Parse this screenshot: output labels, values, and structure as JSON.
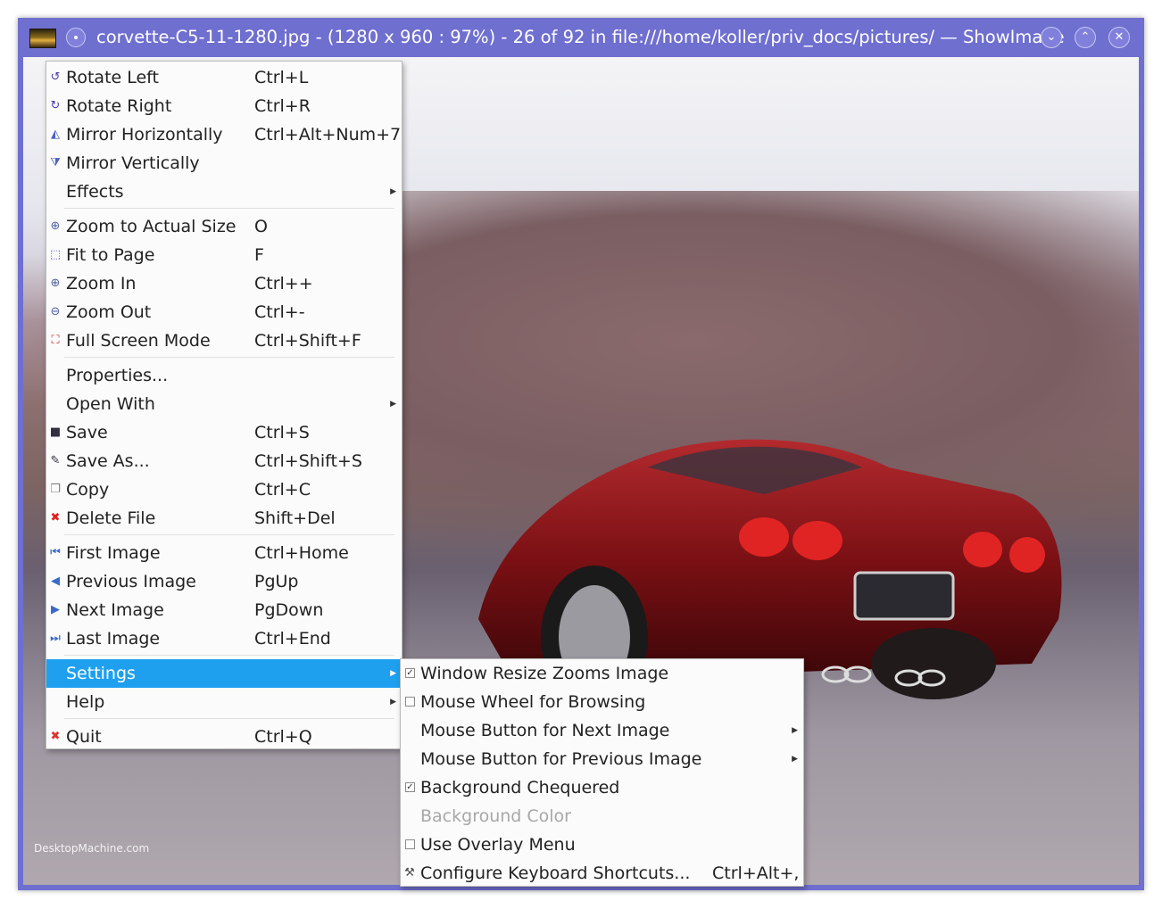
{
  "window": {
    "title": "corvette-C5-11-1280.jpg - (1280 x 960 : 97%) - 26 of 92 in file:///home/koller/priv_docs/pictures/ — ShowImage",
    "buttons": {
      "minimize": "⌄",
      "maximize": "⌃",
      "close": "✕"
    }
  },
  "photo": {
    "watermark": "DesktopMachine.com"
  },
  "main_menu": [
    {
      "id": "rotate-left",
      "label": "Rotate Left",
      "shortcut": "Ctrl+L",
      "icon": "rotate-left-icon",
      "glyph": "↺",
      "color": "#4a3fb0"
    },
    {
      "id": "rotate-right",
      "label": "Rotate Right",
      "shortcut": "Ctrl+R",
      "icon": "rotate-right-icon",
      "glyph": "↻",
      "color": "#4a3fb0"
    },
    {
      "id": "mirror-horizontally",
      "label": "Mirror Horizontally",
      "shortcut": "Ctrl+Alt+Num+7",
      "icon": "mirror-horizontal-icon",
      "glyph": "◭",
      "color": "#4a60c0"
    },
    {
      "id": "mirror-vertically",
      "label": "Mirror Vertically",
      "shortcut": "",
      "icon": "mirror-vertical-icon",
      "glyph": "⧩",
      "color": "#4a60c0"
    },
    {
      "id": "effects",
      "label": "Effects",
      "shortcut": "",
      "submenu": true
    },
    {
      "id": "zoom-actual",
      "label": "Zoom to Actual Size",
      "shortcut": "O",
      "icon": "zoom-actual-icon",
      "glyph": "⊕",
      "color": "#5060a0"
    },
    {
      "id": "fit-to-page",
      "label": "Fit to Page",
      "shortcut": "F",
      "icon": "fit-page-icon",
      "glyph": "⬚",
      "color": "#5060a0"
    },
    {
      "id": "zoom-in",
      "label": "Zoom In",
      "shortcut": "Ctrl++",
      "icon": "zoom-in-icon",
      "glyph": "⊕",
      "color": "#5060a0"
    },
    {
      "id": "zoom-out",
      "label": "Zoom Out",
      "shortcut": "Ctrl+-",
      "icon": "zoom-out-icon",
      "glyph": "⊖",
      "color": "#5060a0"
    },
    {
      "id": "full-screen",
      "label": "Full Screen Mode",
      "shortcut": "Ctrl+Shift+F",
      "icon": "fullscreen-icon",
      "glyph": "⛶",
      "color": "#c03030"
    },
    {
      "id": "properties",
      "label": "Properties...",
      "shortcut": ""
    },
    {
      "id": "open-with",
      "label": "Open With",
      "shortcut": "",
      "submenu": true
    },
    {
      "id": "save",
      "label": "Save",
      "shortcut": "Ctrl+S",
      "icon": "save-icon",
      "glyph": "■",
      "color": "#303040"
    },
    {
      "id": "save-as",
      "label": "Save As...",
      "shortcut": "Ctrl+Shift+S",
      "icon": "save-as-icon",
      "glyph": "✎",
      "color": "#303040"
    },
    {
      "id": "copy",
      "label": "Copy",
      "shortcut": "Ctrl+C",
      "icon": "copy-icon",
      "glyph": "❐",
      "color": "#808080"
    },
    {
      "id": "delete-file",
      "label": "Delete File",
      "shortcut": "Shift+Del",
      "icon": "delete-icon",
      "glyph": "✖",
      "color": "#e02020"
    },
    {
      "id": "first-image",
      "label": "First Image",
      "shortcut": "Ctrl+Home",
      "icon": "first-image-icon",
      "glyph": "⏮",
      "color": "#3a6ac8"
    },
    {
      "id": "previous-image",
      "label": "Previous Image",
      "shortcut": "PgUp",
      "icon": "previous-image-icon",
      "glyph": "◀",
      "color": "#3a6ac8"
    },
    {
      "id": "next-image",
      "label": "Next Image",
      "shortcut": "PgDown",
      "icon": "next-image-icon",
      "glyph": "▶",
      "color": "#3a6ac8"
    },
    {
      "id": "last-image",
      "label": "Last Image",
      "shortcut": "Ctrl+End",
      "icon": "last-image-icon",
      "glyph": "⏭",
      "color": "#3a6ac8"
    },
    {
      "id": "settings",
      "label": "Settings",
      "shortcut": "",
      "submenu": true,
      "highlighted": true
    },
    {
      "id": "help",
      "label": "Help",
      "shortcut": "",
      "submenu": true
    },
    {
      "id": "quit",
      "label": "Quit",
      "shortcut": "Ctrl+Q",
      "icon": "quit-icon",
      "glyph": "✖",
      "color": "#e03030"
    }
  ],
  "settings_menu": [
    {
      "id": "window-resize-zooms",
      "label": "Window Resize Zooms Image",
      "checkbox": true,
      "checked": true
    },
    {
      "id": "mouse-wheel-browsing",
      "label": "Mouse Wheel for Browsing",
      "checkbox": true,
      "checked": false
    },
    {
      "id": "mouse-button-next",
      "label": "Mouse Button for Next Image",
      "submenu": true
    },
    {
      "id": "mouse-button-previous",
      "label": "Mouse Button for Previous Image",
      "submenu": true
    },
    {
      "id": "background-chequered",
      "label": "Background Chequered",
      "checkbox": true,
      "checked": true
    },
    {
      "id": "background-color",
      "label": "Background Color",
      "disabled": true
    },
    {
      "id": "use-overlay-menu",
      "label": "Use Overlay Menu",
      "checkbox": true,
      "checked": false
    },
    {
      "id": "configure-shortcuts",
      "label": "Configure Keyboard Shortcuts...",
      "shortcut": "Ctrl+Alt+,",
      "icon": "configure-icon",
      "glyph": "⚒",
      "color": "#505050"
    }
  ]
}
